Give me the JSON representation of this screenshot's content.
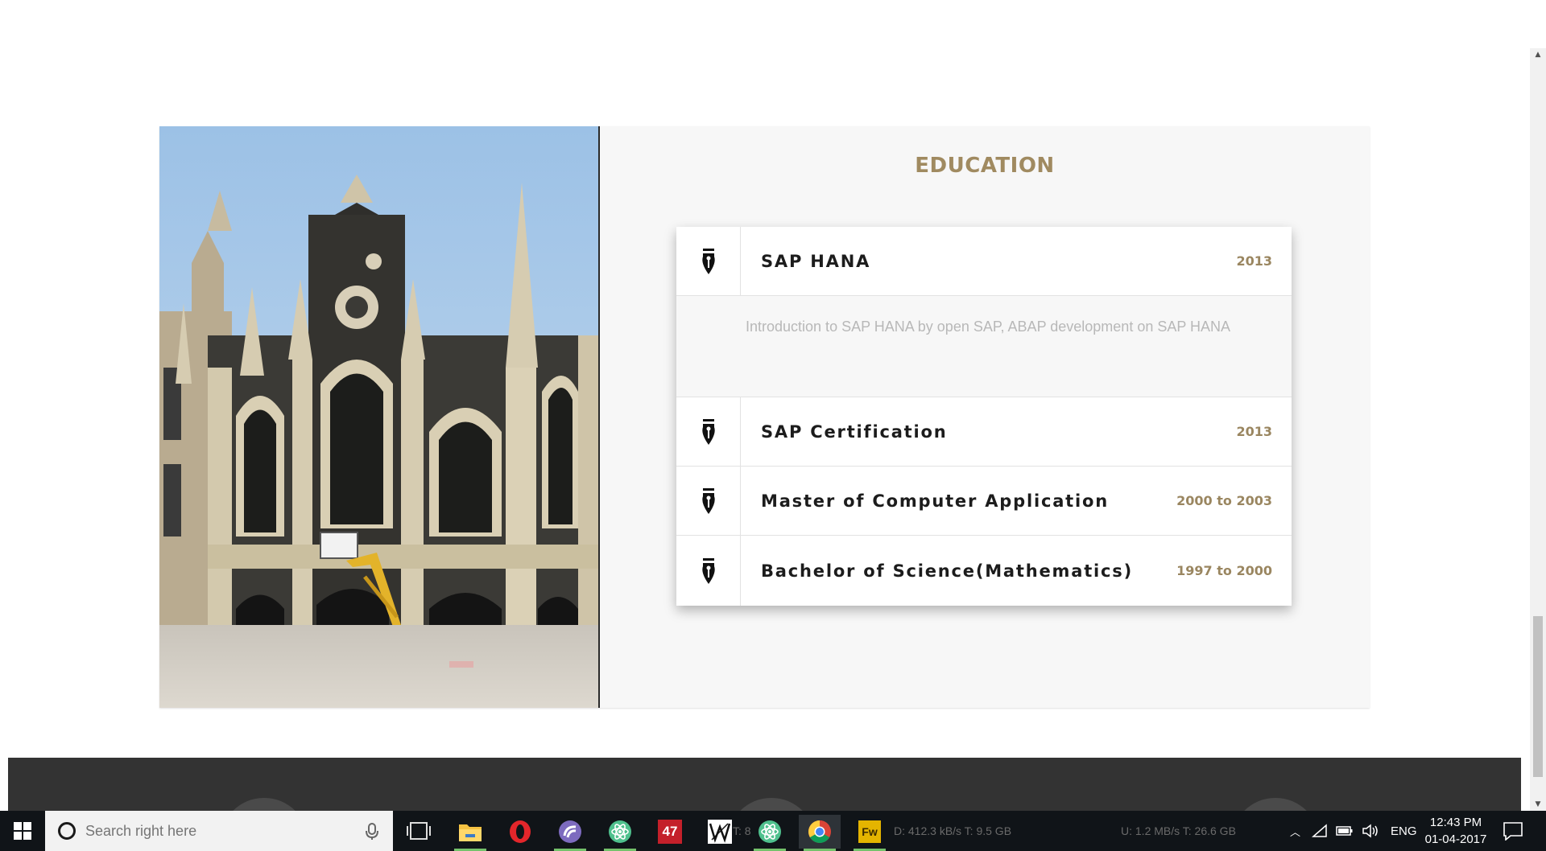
{
  "section": {
    "title": "EDUCATION",
    "items": [
      {
        "title": "SAP HANA",
        "year": "2013",
        "description": "Introduction to SAP HANA by open SAP, ABAP development on SAP HANA"
      },
      {
        "title": "SAP Certification",
        "year": "2013"
      },
      {
        "title": "Master of Computer Application",
        "year": "2000 to 2003"
      },
      {
        "title": "Bachelor of Science(Mathematics)",
        "year": "1997 to 2000"
      }
    ],
    "icon": "fountain-pen-nib-icon"
  },
  "taskbar": {
    "search_placeholder": "Search right here",
    "apps": [
      {
        "name": "file-explorer",
        "icon": "folder-icon",
        "color": "#f5c242"
      },
      {
        "name": "opera",
        "icon": "opera-icon",
        "color": "#e3262b"
      },
      {
        "name": "torrent-client",
        "icon": "bittorrent-icon",
        "color": "#7d6bbf"
      },
      {
        "name": "atom-editor-1",
        "icon": "atom-icon",
        "color": "#4fc08d"
      },
      {
        "name": "app-47",
        "icon": "badge-47-icon",
        "label": "47",
        "color": "#c4202a"
      },
      {
        "name": "inkscape",
        "icon": "wx-icon",
        "color": "#ffffff"
      },
      {
        "name": "atom-editor-2",
        "icon": "atom-icon",
        "color": "#4fc08d"
      },
      {
        "name": "chrome",
        "icon": "chrome-icon"
      },
      {
        "name": "fireworks",
        "icon": "fireworks-icon",
        "label": "Fw",
        "color": "#e4b400"
      }
    ],
    "netmeter": {
      "download": "D: 412.3 kB/s T: 9.5 GB",
      "upload": "U: 1.2 MB/s T: 26.6 GB",
      "left_fragment": "T: 8"
    },
    "tray": {
      "language": "ENG"
    },
    "clock": {
      "time": "12:43 PM",
      "date": "01-04-2017"
    }
  }
}
